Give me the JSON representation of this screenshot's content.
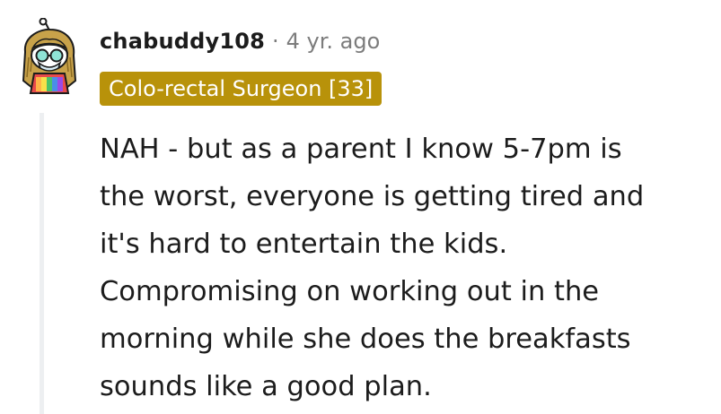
{
  "comment": {
    "author": "chabuddy108",
    "separator": "·",
    "age": "4 yr. ago",
    "flair": "Colo-rectal Surgeon [33]",
    "body_lines": [
      "NAH - but as a parent I know 5-7pm is",
      "the worst, everyone is getting tired and",
      "it's hard to entertain the kids.",
      "Compromising on working out in the",
      "morning while she does the breakfasts",
      "sounds like a good plan."
    ]
  },
  "colors": {
    "flair_background": "#b8920a",
    "flair_text": "#ffffff",
    "username_text": "#1c1c1c",
    "meta_text": "#7c7c7c",
    "thread_line": "#edeff1"
  },
  "icons": {
    "avatar": "snoo-avatar-icon"
  }
}
